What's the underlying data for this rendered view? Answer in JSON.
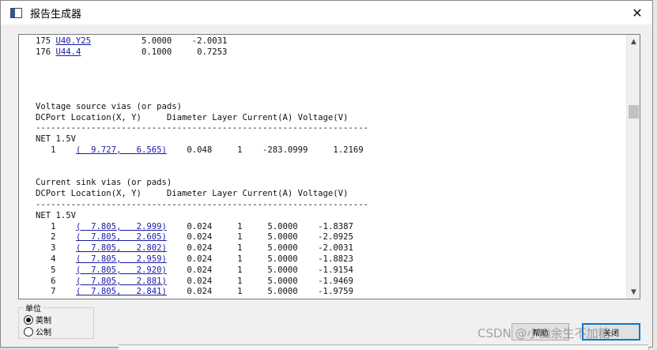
{
  "window": {
    "title": "报告生成器",
    "close_glyph": "✕"
  },
  "report": {
    "lines": [
      [
        {
          "t": "175 "
        },
        {
          "t": "U40.Y25",
          "link": true
        },
        {
          "t": "          5.0000    -2.0031"
        }
      ],
      [
        {
          "t": "176 "
        },
        {
          "t": "U44.4",
          "link": true
        },
        {
          "t": "            0.1000     0.7253"
        }
      ],
      [
        {
          "t": ""
        }
      ],
      [
        {
          "t": ""
        }
      ],
      [
        {
          "t": ""
        }
      ],
      [
        {
          "t": ""
        }
      ],
      [
        {
          "t": "Voltage source vias (or pads)"
        }
      ],
      [
        {
          "t": "DCPort Location(X, Y)     Diameter Layer Current(A) Voltage(V)"
        }
      ],
      [
        {
          "t": "------------------------------------------------------------------"
        }
      ],
      [
        {
          "t": "NET 1.5V"
        }
      ],
      [
        {
          "t": "   1    "
        },
        {
          "t": "(  9.727,   6.565)",
          "link": true
        },
        {
          "t": "    0.048     1    -283.0999     1.2169"
        }
      ],
      [
        {
          "t": ""
        }
      ],
      [
        {
          "t": ""
        }
      ],
      [
        {
          "t": "Current sink vias (or pads)"
        }
      ],
      [
        {
          "t": "DCPort Location(X, Y)     Diameter Layer Current(A) Voltage(V)"
        }
      ],
      [
        {
          "t": "------------------------------------------------------------------"
        }
      ],
      [
        {
          "t": "NET 1.5V"
        }
      ],
      [
        {
          "t": "   1    "
        },
        {
          "t": "(  7.805,   2.999)",
          "link": true
        },
        {
          "t": "    0.024     1     5.0000    -1.8387"
        }
      ],
      [
        {
          "t": "   2    "
        },
        {
          "t": "(  7.805,   2.605)",
          "link": true
        },
        {
          "t": "    0.024     1     5.0000    -2.0925"
        }
      ],
      [
        {
          "t": "   3    "
        },
        {
          "t": "(  7.805,   2.802)",
          "link": true
        },
        {
          "t": "    0.024     1     5.0000    -2.0031"
        }
      ],
      [
        {
          "t": "   4    "
        },
        {
          "t": "(  7.805,   2.959)",
          "link": true
        },
        {
          "t": "    0.024     1     5.0000    -1.8823"
        }
      ],
      [
        {
          "t": "   5    "
        },
        {
          "t": "(  7.805,   2.920)",
          "link": true
        },
        {
          "t": "    0.024     1     5.0000    -1.9154"
        }
      ],
      [
        {
          "t": "   6    "
        },
        {
          "t": "(  7.805,   2.881)",
          "link": true
        },
        {
          "t": "    0.024     1     5.0000    -1.9469"
        }
      ],
      [
        {
          "t": "   7    "
        },
        {
          "t": "(  7.805,   2.841)",
          "link": true
        },
        {
          "t": "    0.024     1     5.0000    -1.9759"
        }
      ]
    ]
  },
  "scrollbar": {
    "up_glyph": "▲",
    "down_glyph": "▼"
  },
  "units": {
    "legend": "单位",
    "options": [
      {
        "label": "英制",
        "checked": true
      },
      {
        "label": "公制",
        "checked": false
      }
    ]
  },
  "buttons": {
    "help": "帮助",
    "close": "关闭"
  },
  "watermark": "CSDN @小幽余生不加糖"
}
